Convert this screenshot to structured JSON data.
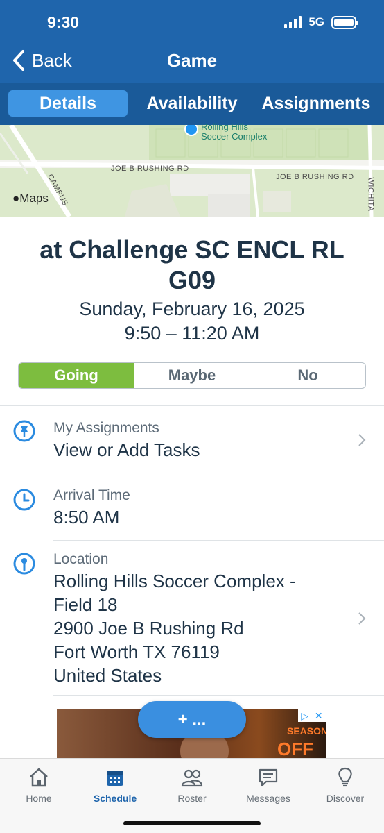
{
  "status_bar": {
    "time": "9:30",
    "network": "5G"
  },
  "nav": {
    "back_label": "Back",
    "title": "Game"
  },
  "tabs": [
    {
      "label": "Details",
      "active": true
    },
    {
      "label": "Availability",
      "active": false
    },
    {
      "label": "Assignments",
      "active": false
    }
  ],
  "map": {
    "pin_label_line1": "Rolling Hills",
    "pin_label_line2": "Soccer Complex",
    "road_label_1": "JOE B RUSHING RD",
    "road_label_2": "JOE B RUSHING RD",
    "road_label_campus": "CAMPUS",
    "road_label_wichita": "WICHITA",
    "maps_brand": "Maps"
  },
  "game": {
    "title": "at Challenge SC ENCL RL G09",
    "date": "Sunday, February 16, 2025",
    "time": "9:50 – 11:20 AM"
  },
  "rsvp": {
    "going": "Going",
    "maybe": "Maybe",
    "no": "No",
    "selected": "Going"
  },
  "assignments": {
    "label": "My Assignments",
    "value": "View or Add Tasks"
  },
  "arrival": {
    "label": "Arrival Time",
    "value": "8:50 AM"
  },
  "location": {
    "label": "Location",
    "line1": "Rolling Hills Soccer Complex -",
    "line2": "Field 18",
    "line3": "2900 Joe B Rushing Rd",
    "line4": "Fort Worth TX 76119",
    "line5": "United States"
  },
  "ad": {
    "word1": "SEASON",
    "word2": "OFF"
  },
  "fab": {
    "label": "+ ..."
  },
  "tabbar": [
    {
      "label": "Home",
      "icon": "home-icon",
      "active": false
    },
    {
      "label": "Schedule",
      "icon": "calendar-icon",
      "active": true
    },
    {
      "label": "Roster",
      "icon": "people-icon",
      "active": false
    },
    {
      "label": "Messages",
      "icon": "message-icon",
      "active": false
    },
    {
      "label": "Discover",
      "icon": "lightbulb-icon",
      "active": false
    }
  ],
  "colors": {
    "header": "#1f65ac",
    "tab_active": "#3f95e2",
    "going": "#7dbd3f",
    "accent": "#2b8be0"
  }
}
